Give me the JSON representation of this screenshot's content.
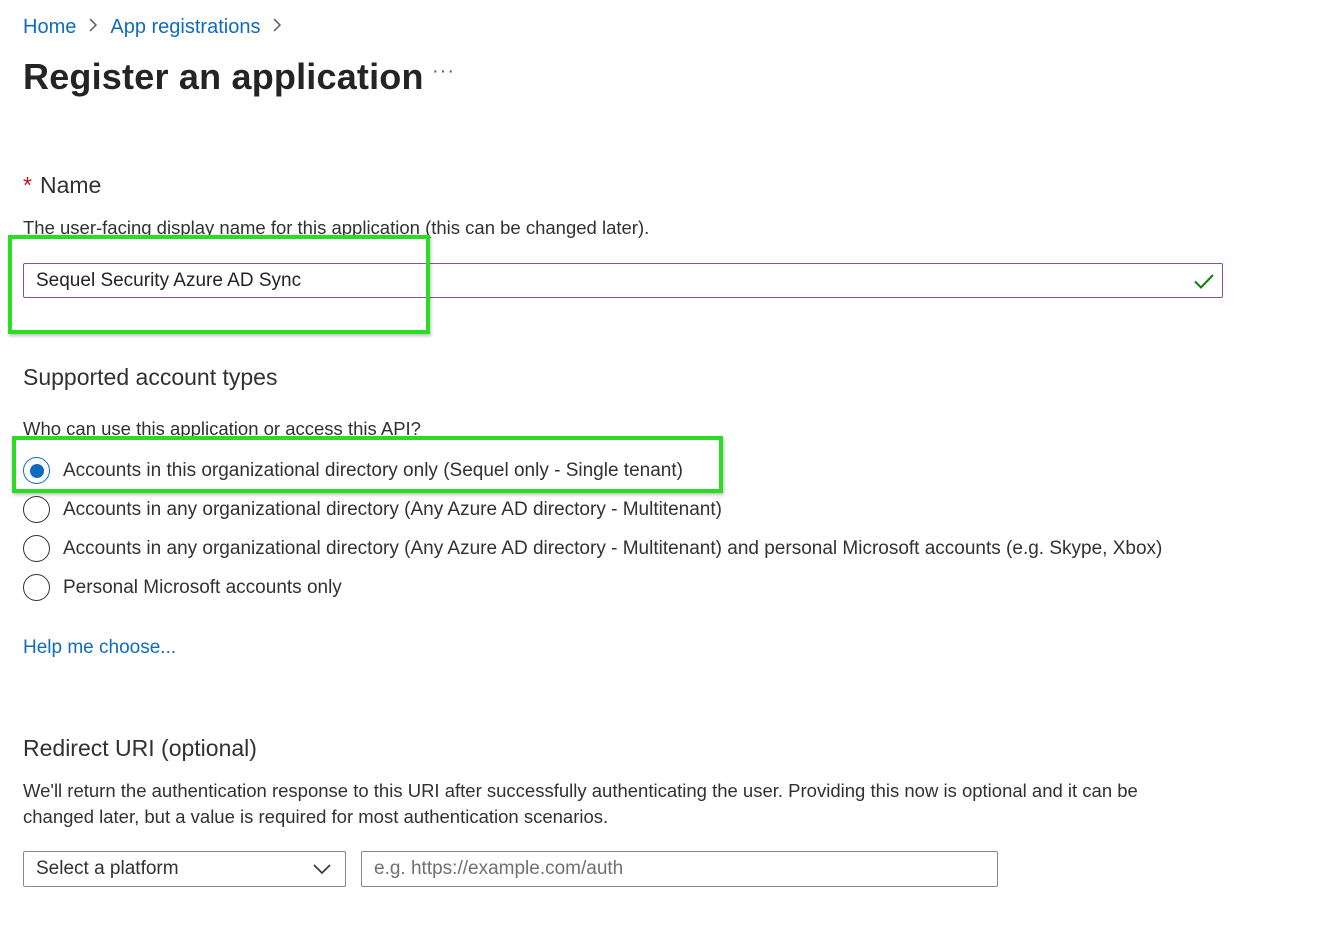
{
  "breadcrumb": {
    "home": "Home",
    "app_registrations": "App registrations",
    "separator": ">"
  },
  "page": {
    "title": "Register an application",
    "more": "···"
  },
  "name_section": {
    "required_marker": "*",
    "label": "Name",
    "description": "The user-facing display name for this application (this can be changed later).",
    "value": "Sequel Security Azure AD Sync",
    "valid_icon": "check-icon"
  },
  "account_types": {
    "heading": "Supported account types",
    "question": "Who can use this application or access this API?",
    "options": [
      {
        "label": "Accounts in this organizational directory only (Sequel only - Single tenant)",
        "checked": true
      },
      {
        "label": "Accounts in any organizational directory (Any Azure AD directory - Multitenant)",
        "checked": false
      },
      {
        "label": "Accounts in any organizational directory (Any Azure AD directory - Multitenant) and personal Microsoft accounts (e.g. Skype, Xbox)",
        "checked": false
      },
      {
        "label": "Personal Microsoft accounts only",
        "checked": false
      }
    ],
    "help_link": "Help me choose..."
  },
  "redirect": {
    "heading": "Redirect URI (optional)",
    "description_line1": "We'll return the authentication response to this URI after successfully authenticating the user. Providing this now is optional and it can be",
    "description_line2": "changed later, but a value is required for most authentication scenarios.",
    "platform_placeholder": "Select a platform",
    "uri_placeholder": "e.g. https://example.com/auth"
  },
  "colors": {
    "accent": "#0f6cbd",
    "highlight": "#2cdc23",
    "success": "#107c10",
    "required": "#c50f1f"
  }
}
